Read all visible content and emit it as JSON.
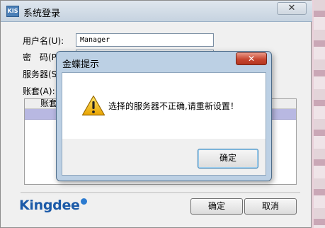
{
  "login": {
    "title": "系统登录",
    "close_glyph": "✕",
    "username_label": "用户名(U):",
    "username_value": "Manager",
    "password_label": "密　码(P):",
    "server_label": "服务器(S):",
    "account_label": "账套(A):",
    "grid_header": "账套",
    "logo_text": "Kingdee",
    "ok_label": "确定",
    "cancel_label": "取消"
  },
  "message": {
    "title": "金蝶提示",
    "close_glyph": "✕",
    "text": "选择的服务器不正确,请重新设置！",
    "ok_label": "确定",
    "icon": "warning-icon"
  },
  "colors": {
    "selection": "#b8b8e2",
    "close_red": "#c74630",
    "brand_blue": "#1b5aa8"
  }
}
